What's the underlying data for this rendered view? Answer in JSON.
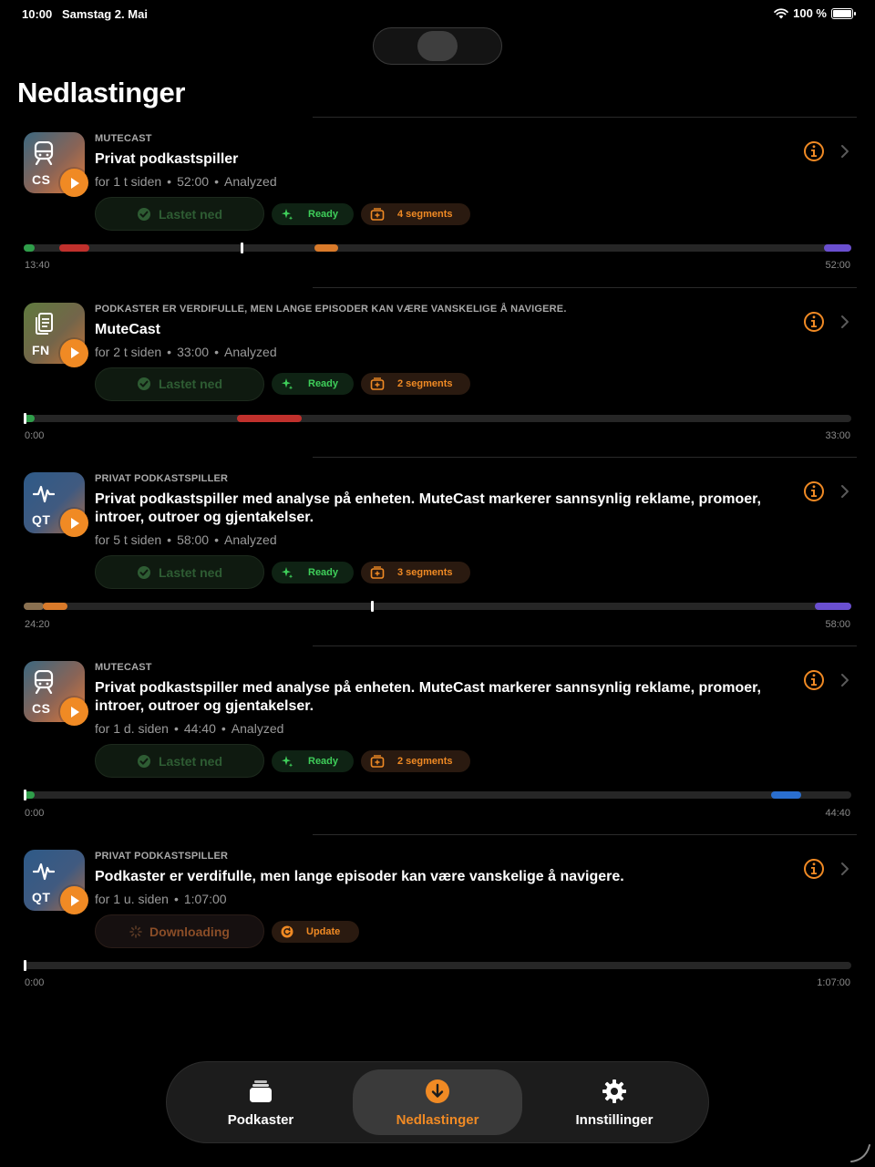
{
  "status": {
    "time": "10:00",
    "date": "Samstag 2. Mai",
    "battery": "100 %"
  },
  "page": {
    "title": "Nedlastinger"
  },
  "colors": {
    "accent": "#f08a24",
    "ready_green": "#3fce5a",
    "background": "#000000"
  },
  "episodes": [
    {
      "artwork_code": "CS",
      "artwork_icon": "train-icon",
      "kicker": "MUTECAST",
      "title": "Privat podkastspiller",
      "ago": "for 1 t siden",
      "duration": "52:00",
      "analysis": "Analyzed",
      "download_label": "Lastet ned",
      "ready_label": "Ready",
      "segments_label": "4 segments",
      "time_start": "13:40",
      "time_end": "52:00"
    },
    {
      "artwork_code": "FN",
      "artwork_icon": "document-icon",
      "kicker": "PODKASTER ER VERDIFULLE, MEN LANGE EPISODER KAN VÆRE VANSKELIGE Å NAVIGERE.",
      "title": "MuteCast",
      "ago": "for 2 t siden",
      "duration": "33:00",
      "analysis": "Analyzed",
      "download_label": "Lastet ned",
      "ready_label": "Ready",
      "segments_label": "2 segments",
      "time_start": "0:00",
      "time_end": "33:00"
    },
    {
      "artwork_code": "QT",
      "artwork_icon": "waveform-icon",
      "kicker": "PRIVAT PODKASTSPILLER",
      "title": "Privat podkastspiller med analyse på enheten. MuteCast markerer sannsynlig reklame, promoer, introer, outroer og gjentakelser.",
      "ago": "for 5 t siden",
      "duration": "58:00",
      "analysis": "Analyzed",
      "download_label": "Lastet ned",
      "ready_label": "Ready",
      "segments_label": "3 segments",
      "time_start": "24:20",
      "time_end": "58:00"
    },
    {
      "artwork_code": "CS",
      "artwork_icon": "train-icon",
      "kicker": "MUTECAST",
      "title": "Privat podkastspiller med analyse på enheten. MuteCast markerer sannsynlig reklame, promoer, introer, outroer og gjentakelser.",
      "ago": "for 1 d. siden",
      "duration": "44:40",
      "analysis": "Analyzed",
      "download_label": "Lastet ned",
      "ready_label": "Ready",
      "segments_label": "2 segments",
      "time_start": "0:00",
      "time_end": "44:40"
    },
    {
      "artwork_code": "QT",
      "artwork_icon": "waveform-icon",
      "kicker": "PRIVAT PODKASTSPILLER",
      "title": "Podkaster er verdifulle, men lange episoder kan være vanskelige å navigere.",
      "ago": "for 1 u. siden",
      "duration": "1:07:00",
      "download_label": "Downloading",
      "update_label": "Update",
      "time_start": "0:00",
      "time_end": "1:07:00"
    }
  ],
  "tabbar": {
    "tabs": [
      {
        "label": "Podkaster",
        "icon": "stack-icon"
      },
      {
        "label": "Nedlastinger",
        "icon": "download-icon",
        "active": true
      },
      {
        "label": "Innstillinger",
        "icon": "gear-icon"
      }
    ]
  }
}
